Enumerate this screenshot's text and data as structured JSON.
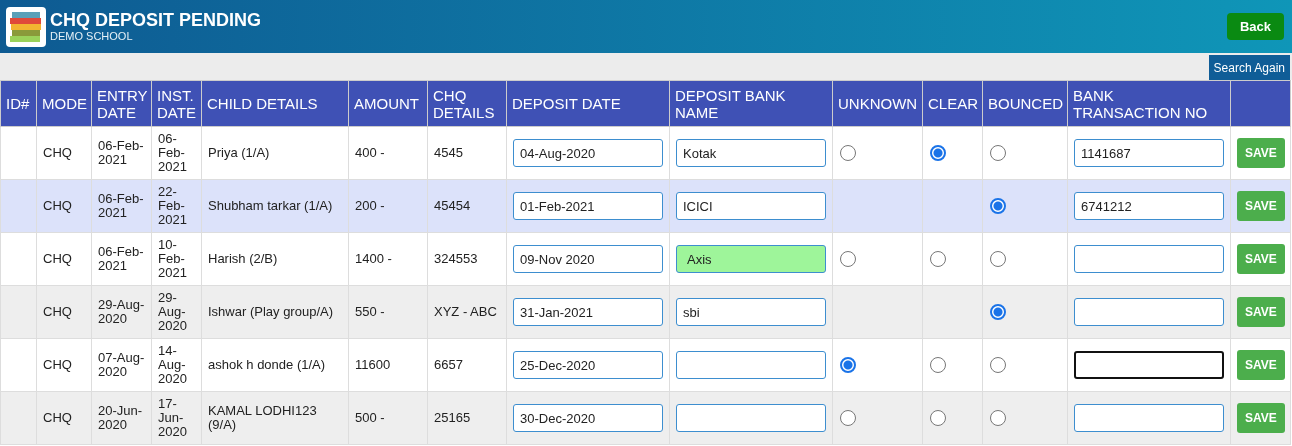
{
  "header": {
    "title": "CHQ DEPOSIT PENDING",
    "subtitle": "DEMO SCHOOL",
    "back_button": "Back"
  },
  "search_again": "Search Again",
  "table": {
    "columns": [
      "ID#",
      "MODE",
      "ENTRY DATE",
      "INST. DATE",
      "CHILD DETAILS",
      "AMOUNT",
      "CHQ DETAILS",
      "DEPOSIT DATE",
      "DEPOSIT BANK NAME",
      "UNKNOWN",
      "CLEAR",
      "BOUNCED",
      "BANK TRANSACTION NO"
    ],
    "rows": [
      {
        "hovered": false,
        "mode": "CHQ",
        "entry_date": "06-Feb-2021",
        "inst_date": "06-Feb-2021",
        "child": "Priya (1/A)",
        "amount": "400 -",
        "chq": "4545",
        "deposit_date": "04-Aug-2020",
        "bank_name": "Kotak",
        "bank_name_highlighted": false,
        "unknown": {
          "selected": false
        },
        "clear": {
          "selected": true
        },
        "bounced": {
          "selected": false
        },
        "transaction_no": "1141687",
        "transaction_focused": false,
        "save": "SAVE"
      },
      {
        "hovered": true,
        "mode": "CHQ",
        "entry_date": "06-Feb-2021",
        "inst_date": "22-Feb-2021",
        "child": "Shubham tarkar (1/A)",
        "amount": "200 -",
        "chq": "45454",
        "deposit_date": "01-Feb-2021",
        "bank_name": "ICICI",
        "bank_name_highlighted": false,
        "bounced": {
          "selected": true
        },
        "transaction_no": "6741212",
        "transaction_focused": false,
        "save": "SAVE"
      },
      {
        "hovered": false,
        "mode": "CHQ",
        "entry_date": "06-Feb-2021",
        "inst_date": "10-Feb-2021",
        "child": "Harish (2/B)",
        "amount": "1400 -",
        "chq": "324553",
        "deposit_date": "09-Nov 2020",
        "bank_name": "Axis",
        "bank_name_highlighted": true,
        "unknown": {
          "selected": false
        },
        "clear": {
          "selected": false
        },
        "bounced": {
          "selected": false
        },
        "transaction_focused": false,
        "save": "SAVE"
      },
      {
        "hovered": false,
        "mode": "CHQ",
        "entry_date": "29-Aug-2020",
        "inst_date": "29-Aug-2020",
        "child": "Ishwar (Play group/A)",
        "amount": "550 -",
        "chq": "XYZ - ABC",
        "deposit_date": "31-Jan-2021",
        "bank_name": "sbi",
        "bank_name_highlighted": false,
        "bounced": {
          "selected": true
        },
        "transaction_focused": false,
        "save": "SAVE"
      },
      {
        "hovered": false,
        "mode": "CHQ",
        "entry_date": "07-Aug-2020",
        "inst_date": "14-Aug-2020",
        "child": "ashok h donde (1/A)",
        "amount": "11600",
        "chq": "6657",
        "deposit_date": "25-Dec-2020",
        "bank_name_highlighted": false,
        "unknown": {
          "selected": true
        },
        "clear": {
          "selected": false
        },
        "bounced": {
          "selected": false
        },
        "transaction_focused": true,
        "save": "SAVE"
      },
      {
        "hovered": false,
        "mode": "CHQ",
        "entry_date": "20-Jun-2020",
        "inst_date": "17-Jun-2020",
        "child": "KAMAL LODHI123 (9/A)",
        "amount": "500 -",
        "chq": "25165",
        "deposit_date": "30-Dec-2020",
        "bank_name_highlighted": false,
        "unknown": {
          "selected": false
        },
        "clear": {
          "selected": false
        },
        "bounced": {
          "selected": false
        },
        "transaction_focused": false,
        "save": "SAVE"
      }
    ]
  }
}
